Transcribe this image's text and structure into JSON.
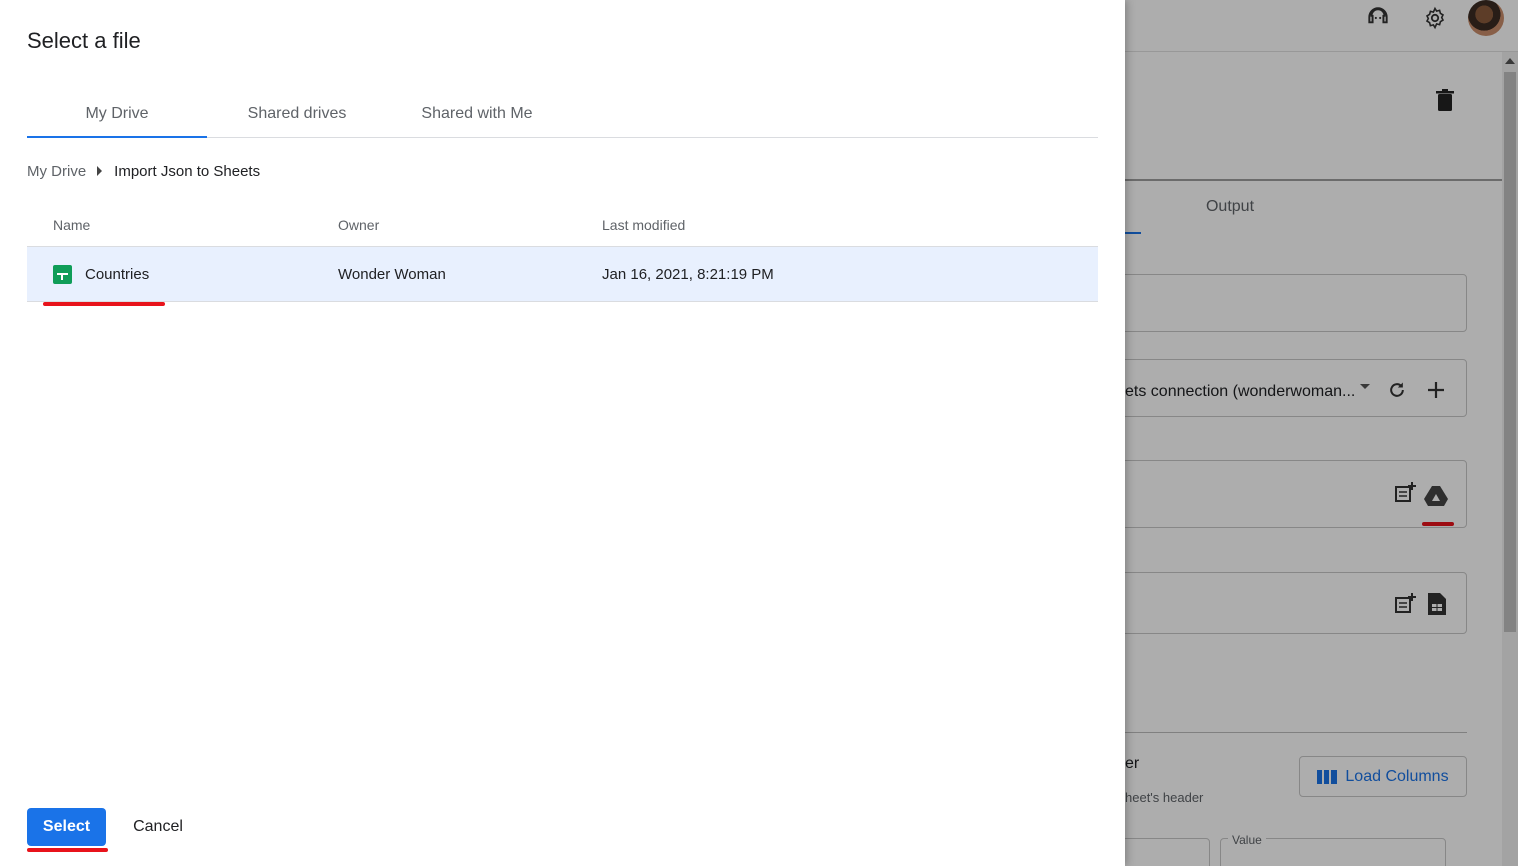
{
  "dialog": {
    "title": "Select a file",
    "tabs": [
      {
        "label": "My Drive",
        "active": true
      },
      {
        "label": "Shared drives",
        "active": false
      },
      {
        "label": "Shared with Me",
        "active": false
      }
    ],
    "breadcrumb": {
      "root": "My Drive",
      "current": "Import Json to Sheets"
    },
    "columns": {
      "name": "Name",
      "owner": "Owner",
      "modified": "Last modified"
    },
    "files": [
      {
        "name": "Countries",
        "owner": "Wonder Woman",
        "modified": "Jan 16, 2021, 8:21:19 PM",
        "icon": "google-sheets-icon",
        "selected": true
      }
    ],
    "select_label": "Select",
    "cancel_label": "Cancel"
  },
  "background_app": {
    "tab_output": "Output",
    "connection_text": "ets connection (wonderwoman...",
    "header_label": "er",
    "header_hint": "heet's header",
    "load_columns_label": "Load Columns",
    "value_label": "Value"
  },
  "colors": {
    "accent": "#1a73e8",
    "selected_row": "#e8f0fe",
    "highlight_mark": "#e8131b",
    "sheets_green": "#0f9d58"
  }
}
